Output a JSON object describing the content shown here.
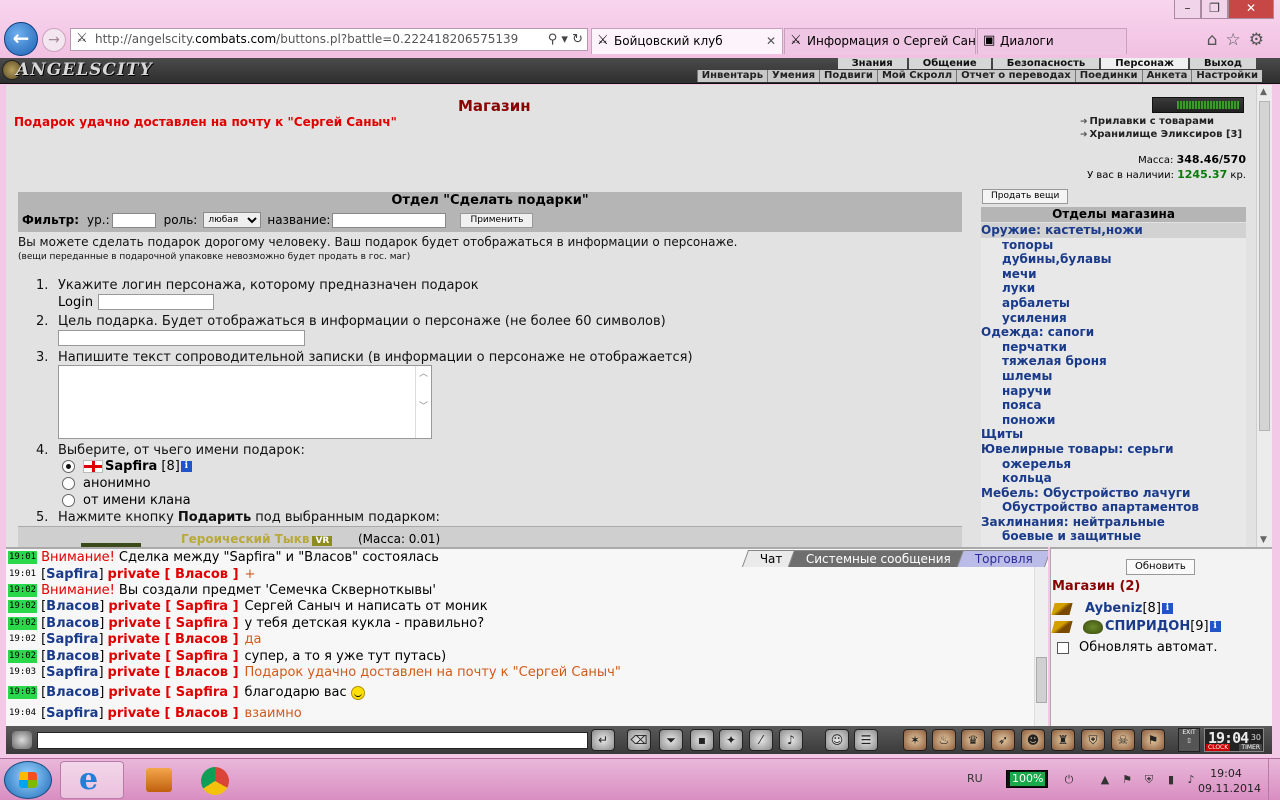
{
  "browser": {
    "url_prefix": "http://angelscity.",
    "url_domain": "combats.com",
    "url_suffix": "/buttons.pl?battle=0.222418206575139",
    "tabs": [
      {
        "label": "Бойцовский клуб",
        "active": true
      },
      {
        "label": "Информация о Сергей Сан...",
        "active": false
      },
      {
        "label": "Диалоги",
        "active": false
      }
    ]
  },
  "game": {
    "logo": "ANGELSCITY",
    "top_menu": [
      "Знания",
      "Общение",
      "Безопасность",
      "Персонаж",
      "Выход"
    ],
    "top_menu_selected": "Персонаж",
    "sub_menu": [
      "Инвентарь",
      "Умения",
      "Подвиги",
      "Мой Скролл",
      "Отчет о переводах",
      "Поединки",
      "Анкета",
      "Настройки"
    ]
  },
  "shop": {
    "title": "Магазин",
    "success": "Подарок удачно доставлен на почту к \"Сергей Саныч\"",
    "links": [
      "Прилавки с товарами",
      "Хранилище Эликсиров [3]"
    ],
    "mass_label": "Масса:",
    "mass_value": "348.46/570",
    "money_label": "У вас в наличии:",
    "money_value": "1245.37",
    "money_unit": "кр.",
    "dept_title": "Отдел \"Сделать подарки\"",
    "filter": {
      "label": "Фильтр:",
      "level_label": "ур.:",
      "role_label": "роль:",
      "role_value": "любая",
      "name_label": "название:",
      "apply": "Применить"
    },
    "desc": "Вы можете сделать подарок дорогому человеку. Ваш подарок будет отображаться в информации о персонаже.",
    "note": "(вещи переданные в подарочной упаковке невозможно будет продать в гос. маг)",
    "steps": [
      {
        "num": "1.",
        "text": "Укажите логин персонажа, которому предназначен подарок"
      },
      {
        "num": "2.",
        "text": "Цель подарка. Будет отображаться в информации о персонаже (не более 60 символов)"
      },
      {
        "num": "3.",
        "text": "Напишите текст сопроводительной записки (в информации о персонаже не отображается)"
      },
      {
        "num": "4.",
        "text": "Выберите, от чьего имени подарок:"
      },
      {
        "num": "5.",
        "text_a": "Нажмите кнопку ",
        "text_b": "Подарить",
        "text_c": " под выбранным подарком:"
      }
    ],
    "login_label": "Login",
    "from_options": {
      "self_name": "Sapfira",
      "self_level": "[8]",
      "anon": "анонимно",
      "clan": "от имени клана"
    },
    "item": {
      "name": "Героический Тыкв",
      "badge": "VR",
      "mass": "(Масса: 0.01)"
    },
    "sell_button": "Продать вещи",
    "dept_list_title": "Отделы магазина",
    "dept_list": [
      {
        "label": "Оружие: кастеты,ножи",
        "sub": false,
        "sel": true
      },
      {
        "label": "топоры",
        "sub": true
      },
      {
        "label": "дубины,булавы",
        "sub": true
      },
      {
        "label": "мечи",
        "sub": true
      },
      {
        "label": "луки",
        "sub": true
      },
      {
        "label": "арбалеты",
        "sub": true
      },
      {
        "label": "усиления",
        "sub": true
      },
      {
        "label": "Одежда: сапоги",
        "sub": false
      },
      {
        "label": "перчатки",
        "sub": true
      },
      {
        "label": "тяжелая броня",
        "sub": true
      },
      {
        "label": "шлемы",
        "sub": true
      },
      {
        "label": "наручи",
        "sub": true
      },
      {
        "label": "пояса",
        "sub": true
      },
      {
        "label": "поножи",
        "sub": true
      },
      {
        "label": "Щиты",
        "sub": false
      },
      {
        "label": "Ювелирные товары: серьги",
        "sub": false
      },
      {
        "label": "ожерелья",
        "sub": true
      },
      {
        "label": "кольца",
        "sub": true
      },
      {
        "label": "Мебель: Обустройство лачуги",
        "sub": false
      },
      {
        "label": "Обустройство апартаментов",
        "sub": true
      },
      {
        "label": "Заклинания: нейтральные",
        "sub": false
      },
      {
        "label": "боевые и защитные",
        "sub": true
      }
    ]
  },
  "chat": {
    "tabs": [
      "Чат",
      "Системные сообщения",
      "Торговля"
    ],
    "messages": [
      {
        "time": "19:01",
        "hl": true,
        "warn": "Внимание!",
        "text": "Сделка между \"Sapfira\" и \"Власов\" состоялась"
      },
      {
        "time": "19:01",
        "hl": false,
        "from": "Sapfira",
        "to": "Власов",
        "text": "+",
        "orange": true
      },
      {
        "time": "19:02",
        "hl": true,
        "warn": "Внимание!",
        "text": "Вы создали предмет 'Семечка Скверноткывы'"
      },
      {
        "time": "19:02",
        "hl": true,
        "from": "Власов",
        "to": "Sapfira",
        "text": "Сергей Саныч и написать от моник",
        "orange": false
      },
      {
        "time": "19:02",
        "hl": true,
        "from": "Власов",
        "to": "Sapfira",
        "text": "у тебя детская кукла - правильно?",
        "orange": false
      },
      {
        "time": "19:02",
        "hl": false,
        "from": "Sapfira",
        "to": "Власов",
        "text": "да",
        "orange": true
      },
      {
        "time": "19:02",
        "hl": true,
        "from": "Власов",
        "to": "Sapfira",
        "text": "супер, а то я уже тут путась)",
        "orange": false
      },
      {
        "time": "19:03",
        "hl": false,
        "from": "Sapfira",
        "to": "Власов",
        "text": "Подарок удачно доставлен на почту к \"Сергей Саныч\"",
        "orange": true
      },
      {
        "time": "19:03",
        "hl": true,
        "from": "Власов",
        "to": "Sapfira",
        "text": "благодарю вас",
        "orange": false,
        "smile": true
      },
      {
        "time": "19:04",
        "hl": false,
        "from": "Sapfira",
        "to": "Власов",
        "text": "взаимно",
        "orange": true
      }
    ],
    "private_word": "private"
  },
  "online": {
    "refresh": "Обновить",
    "title": "Магазин (2)",
    "users": [
      {
        "name": "Aybeniz",
        "level": "[8]"
      },
      {
        "name": "СПИРИДОН",
        "level": "[9]"
      }
    ],
    "auto": "Обновлять автомат."
  },
  "chatbar": {
    "clock": "19:04",
    "seconds": "30",
    "clock_label": "CLOCK",
    "timer_label": "TIMER",
    "exit_label": "EXIT"
  },
  "taskbar": {
    "lang": "RU",
    "battery": "100%",
    "time": "19:04",
    "date": "09.11.2014"
  }
}
